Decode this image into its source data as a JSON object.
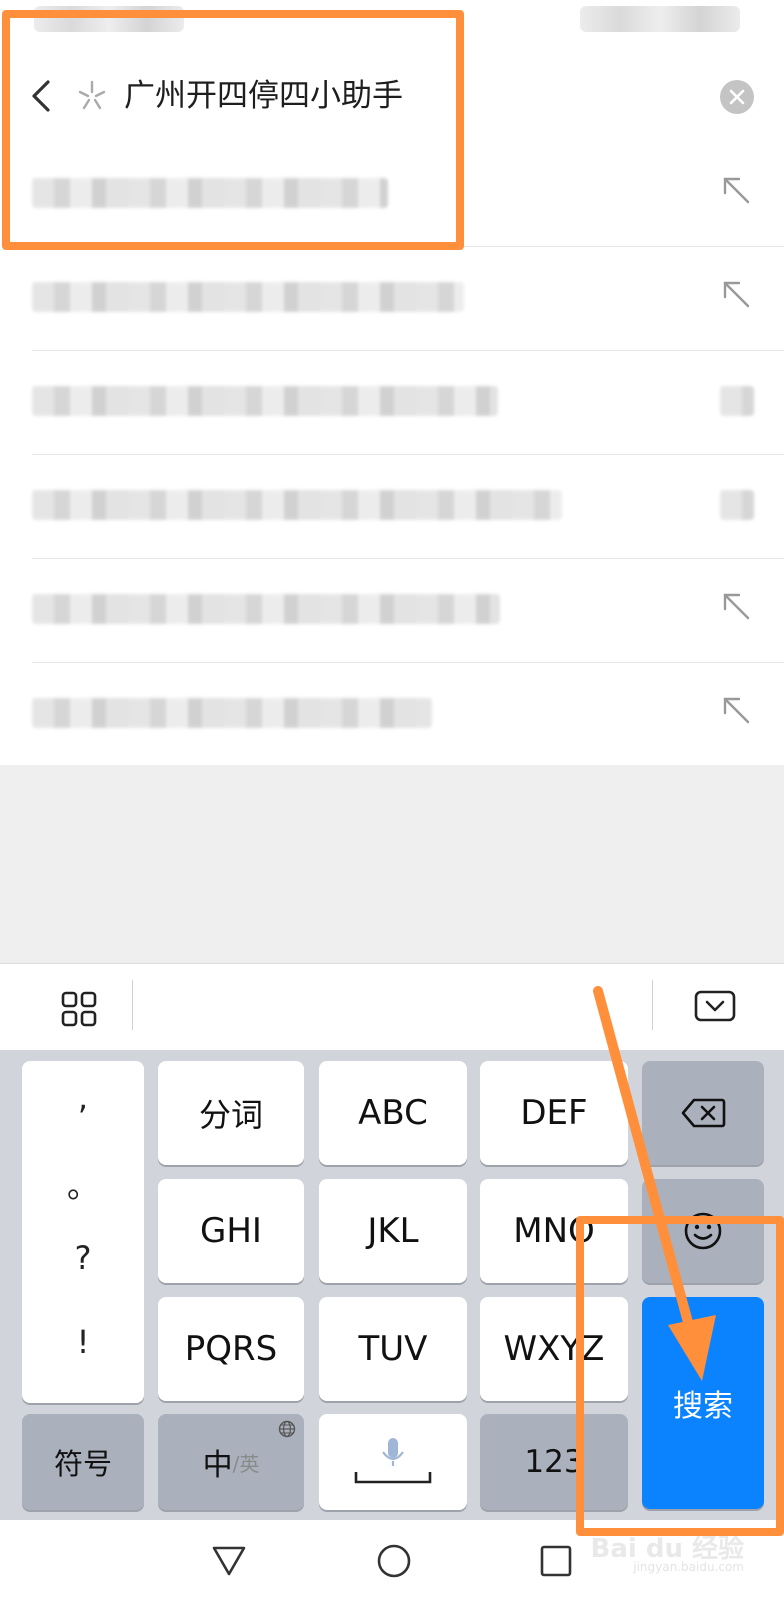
{
  "search": {
    "query": "广州开四停四小助手"
  },
  "keyboard": {
    "punctuation": [
      ",",
      "。",
      "?",
      "!"
    ],
    "rows": [
      [
        "分词",
        "ABC",
        "DEF"
      ],
      [
        "GHI",
        "JKL",
        "MNO"
      ],
      [
        "PQRS",
        "TUV",
        "WXYZ"
      ]
    ],
    "symbols_label": "符号",
    "lang_main": "中",
    "lang_alt": "/英",
    "numbers_label": "123",
    "search_label": "搜索"
  },
  "watermark": {
    "main": "Bai du 经验",
    "sub": "jingyan.baidu.com"
  },
  "colors": {
    "accent": "#0b83ff",
    "annotation": "#ff8f3a"
  }
}
